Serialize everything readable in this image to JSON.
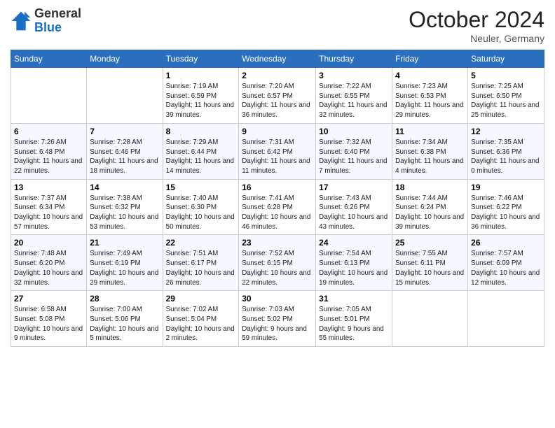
{
  "header": {
    "logo": {
      "line1": "General",
      "line2": "Blue"
    },
    "title": "October 2024",
    "location": "Neuler, Germany"
  },
  "days_of_week": [
    "Sunday",
    "Monday",
    "Tuesday",
    "Wednesday",
    "Thursday",
    "Friday",
    "Saturday"
  ],
  "weeks": [
    [
      {
        "day": "",
        "info": ""
      },
      {
        "day": "",
        "info": ""
      },
      {
        "day": "1",
        "info": "Sunrise: 7:19 AM\nSunset: 6:59 PM\nDaylight: 11 hours and 39 minutes."
      },
      {
        "day": "2",
        "info": "Sunrise: 7:20 AM\nSunset: 6:57 PM\nDaylight: 11 hours and 36 minutes."
      },
      {
        "day": "3",
        "info": "Sunrise: 7:22 AM\nSunset: 6:55 PM\nDaylight: 11 hours and 32 minutes."
      },
      {
        "day": "4",
        "info": "Sunrise: 7:23 AM\nSunset: 6:53 PM\nDaylight: 11 hours and 29 minutes."
      },
      {
        "day": "5",
        "info": "Sunrise: 7:25 AM\nSunset: 6:50 PM\nDaylight: 11 hours and 25 minutes."
      }
    ],
    [
      {
        "day": "6",
        "info": "Sunrise: 7:26 AM\nSunset: 6:48 PM\nDaylight: 11 hours and 22 minutes."
      },
      {
        "day": "7",
        "info": "Sunrise: 7:28 AM\nSunset: 6:46 PM\nDaylight: 11 hours and 18 minutes."
      },
      {
        "day": "8",
        "info": "Sunrise: 7:29 AM\nSunset: 6:44 PM\nDaylight: 11 hours and 14 minutes."
      },
      {
        "day": "9",
        "info": "Sunrise: 7:31 AM\nSunset: 6:42 PM\nDaylight: 11 hours and 11 minutes."
      },
      {
        "day": "10",
        "info": "Sunrise: 7:32 AM\nSunset: 6:40 PM\nDaylight: 11 hours and 7 minutes."
      },
      {
        "day": "11",
        "info": "Sunrise: 7:34 AM\nSunset: 6:38 PM\nDaylight: 11 hours and 4 minutes."
      },
      {
        "day": "12",
        "info": "Sunrise: 7:35 AM\nSunset: 6:36 PM\nDaylight: 11 hours and 0 minutes."
      }
    ],
    [
      {
        "day": "13",
        "info": "Sunrise: 7:37 AM\nSunset: 6:34 PM\nDaylight: 10 hours and 57 minutes."
      },
      {
        "day": "14",
        "info": "Sunrise: 7:38 AM\nSunset: 6:32 PM\nDaylight: 10 hours and 53 minutes."
      },
      {
        "day": "15",
        "info": "Sunrise: 7:40 AM\nSunset: 6:30 PM\nDaylight: 10 hours and 50 minutes."
      },
      {
        "day": "16",
        "info": "Sunrise: 7:41 AM\nSunset: 6:28 PM\nDaylight: 10 hours and 46 minutes."
      },
      {
        "day": "17",
        "info": "Sunrise: 7:43 AM\nSunset: 6:26 PM\nDaylight: 10 hours and 43 minutes."
      },
      {
        "day": "18",
        "info": "Sunrise: 7:44 AM\nSunset: 6:24 PM\nDaylight: 10 hours and 39 minutes."
      },
      {
        "day": "19",
        "info": "Sunrise: 7:46 AM\nSunset: 6:22 PM\nDaylight: 10 hours and 36 minutes."
      }
    ],
    [
      {
        "day": "20",
        "info": "Sunrise: 7:48 AM\nSunset: 6:20 PM\nDaylight: 10 hours and 32 minutes."
      },
      {
        "day": "21",
        "info": "Sunrise: 7:49 AM\nSunset: 6:19 PM\nDaylight: 10 hours and 29 minutes."
      },
      {
        "day": "22",
        "info": "Sunrise: 7:51 AM\nSunset: 6:17 PM\nDaylight: 10 hours and 26 minutes."
      },
      {
        "day": "23",
        "info": "Sunrise: 7:52 AM\nSunset: 6:15 PM\nDaylight: 10 hours and 22 minutes."
      },
      {
        "day": "24",
        "info": "Sunrise: 7:54 AM\nSunset: 6:13 PM\nDaylight: 10 hours and 19 minutes."
      },
      {
        "day": "25",
        "info": "Sunrise: 7:55 AM\nSunset: 6:11 PM\nDaylight: 10 hours and 15 minutes."
      },
      {
        "day": "26",
        "info": "Sunrise: 7:57 AM\nSunset: 6:09 PM\nDaylight: 10 hours and 12 minutes."
      }
    ],
    [
      {
        "day": "27",
        "info": "Sunrise: 6:58 AM\nSunset: 5:08 PM\nDaylight: 10 hours and 9 minutes."
      },
      {
        "day": "28",
        "info": "Sunrise: 7:00 AM\nSunset: 5:06 PM\nDaylight: 10 hours and 5 minutes."
      },
      {
        "day": "29",
        "info": "Sunrise: 7:02 AM\nSunset: 5:04 PM\nDaylight: 10 hours and 2 minutes."
      },
      {
        "day": "30",
        "info": "Sunrise: 7:03 AM\nSunset: 5:02 PM\nDaylight: 9 hours and 59 minutes."
      },
      {
        "day": "31",
        "info": "Sunrise: 7:05 AM\nSunset: 5:01 PM\nDaylight: 9 hours and 55 minutes."
      },
      {
        "day": "",
        "info": ""
      },
      {
        "day": "",
        "info": ""
      }
    ]
  ]
}
